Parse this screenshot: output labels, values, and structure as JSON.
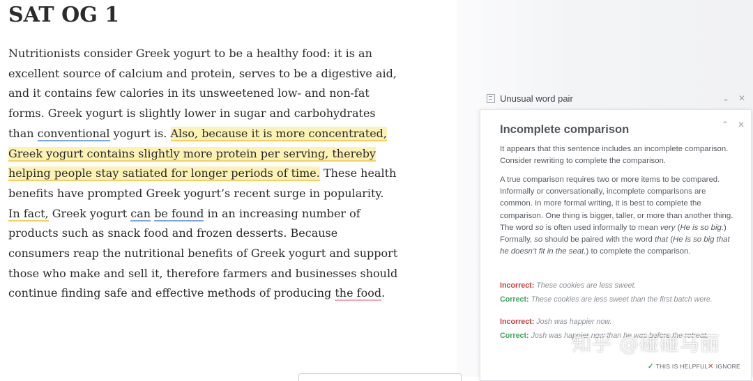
{
  "document": {
    "title": "SAT OG 1",
    "segments": [
      {
        "text": "Nutritionists consider Greek yogurt to be a healthy food: it is an excellent source of calcium and protein, serves to be a digestive aid, and it contains few calories in its unsweetened low- and non-fat forms. Greek yogurt is slightly lower in sugar and carbohydrates than ",
        "mark": "none"
      },
      {
        "text": "conventional",
        "mark": "underline-blue"
      },
      {
        "text": " yogurt is. ",
        "mark": "none"
      },
      {
        "text": "Also, because it is more concentrated, Greek yogurt contains slightly more protein per serving, thereby helping people stay satiated for longer periods of time.",
        "mark": "highlight-yellow"
      },
      {
        "text": " These health benefits have prompted Greek yogurt’s recent surge in popularity. ",
        "mark": "none"
      },
      {
        "text": "In fact,",
        "mark": "underline-yellow"
      },
      {
        "text": " Greek yogurt ",
        "mark": "none"
      },
      {
        "text": "can",
        "mark": "underline-blue"
      },
      {
        "text": " ",
        "mark": "none"
      },
      {
        "text": "be found",
        "mark": "underline-blue"
      },
      {
        "text": " in an increasing number of products such as snack food and frozen desserts. Because consumers reap the nutritional benefits of Greek yogurt and support those who make and sell it, therefore farmers and businesses should continue finding safe and effective methods of producing ",
        "mark": "none"
      },
      {
        "text": "the food",
        "mark": "underline-pink"
      },
      {
        "text": ".",
        "mark": "none"
      }
    ]
  },
  "collapsed_card": {
    "icon": "book-icon",
    "label": "Unusual word pair"
  },
  "card": {
    "title": "Incomplete comparison",
    "intro": "It appears that this sentence includes an incomplete comparison. Consider rewriting to complete the comparison.",
    "explanation": [
      {
        "t": "A true comparison requires two or more items to be compared. Informally or conversationally, incomplete comparisons are common. In more formal writing, it is best to complete the comparison. One thing is bigger, taller, or more than another thing. The word ",
        "i": false
      },
      {
        "t": "so",
        "i": true
      },
      {
        "t": " is often used informally to mean ",
        "i": false
      },
      {
        "t": "very",
        "i": true
      },
      {
        "t": " (",
        "i": false
      },
      {
        "t": "He is so big.",
        "i": true
      },
      {
        "t": ") Formally, ",
        "i": false
      },
      {
        "t": "so",
        "i": true
      },
      {
        "t": " should be paired with the word ",
        "i": false
      },
      {
        "t": "that",
        "i": true
      },
      {
        "t": " (",
        "i": false
      },
      {
        "t": "He is so big that he doesn’t fit in the seat.",
        "i": true
      },
      {
        "t": ") to complete the comparison.",
        "i": false
      }
    ],
    "examples": [
      {
        "incorrect_label": "Incorrect:",
        "incorrect": "These cookies are less sweet.",
        "correct_label": "Correct:",
        "correct": "These cookies are less sweet than the first batch were."
      },
      {
        "incorrect_label": "Incorrect:",
        "incorrect": "Josh was happier now.",
        "correct_label": "Correct:",
        "correct": "Josh was happier now than he was before the retreat."
      }
    ],
    "footer": {
      "helpful_label": "THIS IS HELPFUL",
      "ignore_label": "IGNORE"
    }
  },
  "watermark": "知乎 @碰碰马丽",
  "colors": {
    "highlight": "#fdf2b5",
    "incorrect": "#d43a3a",
    "correct": "#3ea55a"
  }
}
